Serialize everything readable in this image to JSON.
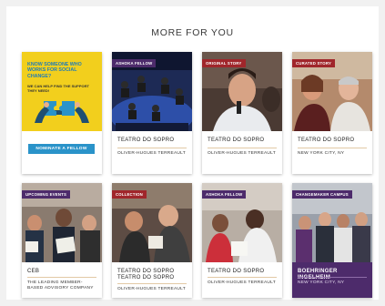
{
  "section": {
    "title": "MORE FOR YOU"
  },
  "colors": {
    "accent_blue": "#2a93c9",
    "badge_purple": "#4d2b6b",
    "badge_red": "#a0262b",
    "cta_yellow": "#f2cf1d",
    "rule_tan": "#e2c9a6"
  },
  "cards": [
    {
      "type": "cta",
      "headline": "KNOW SOMEONE WHO WORKS FOR SOCIAL CHANGE?",
      "subtext": "WE CAN HELP FIND THE SUPPORT THEY NEED!",
      "button": "NOMINATE A FELLOW",
      "icon": "puzzle-hands-icon"
    },
    {
      "badge": "ASHOKA FELLOW",
      "title": "TEATRO DO SOPRO",
      "subtitle": "OLIVER-HUGUES TERREAULT"
    },
    {
      "badge": "ORIGINAL STORY",
      "title": "TEATRO DO SOPRO",
      "subtitle": "OLIVER-HUGUES TERREAULT"
    },
    {
      "badge": "CURATED STORY",
      "title": "TEATRO DO SOPRO",
      "subtitle": "NEW YORK CITY, NY"
    },
    {
      "badge": "UPCOMING EVENTS",
      "title": "CEB",
      "subtitle": "THE LEADING MEMBER-BASED ADVISORY COMPANY"
    },
    {
      "badge": "COLLECTION",
      "title": "TEATRO DO SOPRO TEATRO DO SOPRO",
      "subtitle": "OLIVER-HUGUES TERREAULT"
    },
    {
      "badge": "ASHOKA FELLOW",
      "title": "TEATRO DO SOPRO",
      "subtitle": "OLIVER-HUGUES TERREAULT"
    },
    {
      "badge": "CHANGEMAKER CAMPUS",
      "title": "BOEHRINGER INGELHEIM",
      "subtitle": "NEW YORK CITY, NY"
    }
  ]
}
